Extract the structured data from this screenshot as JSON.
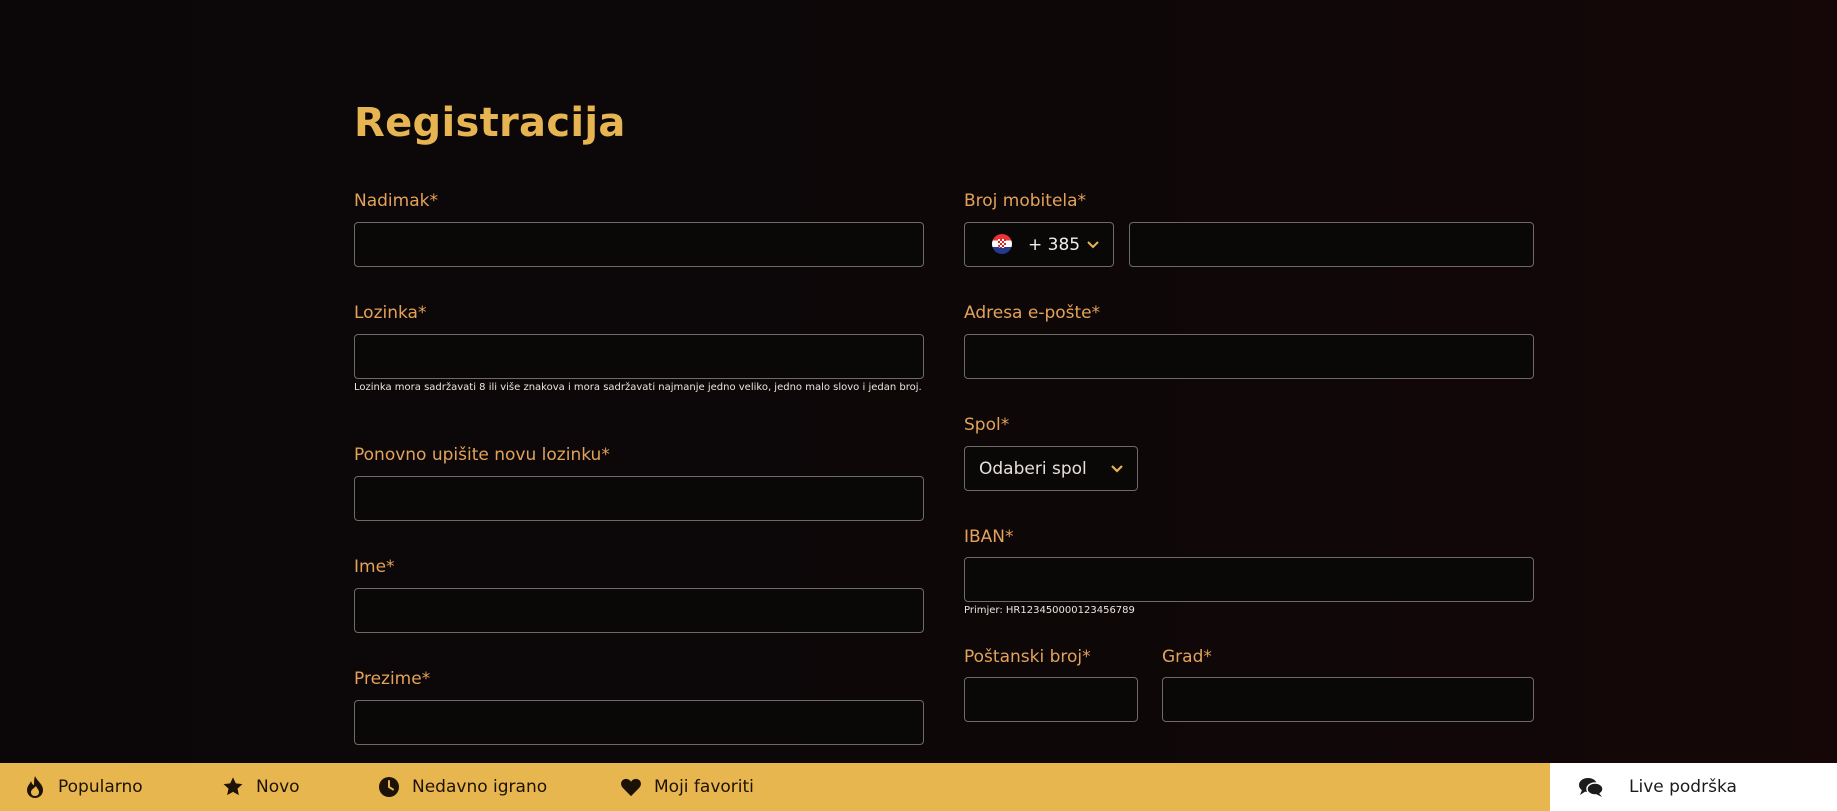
{
  "page": {
    "title": "Registracija"
  },
  "form": {
    "nickname": {
      "label": "Nadimak*",
      "value": ""
    },
    "password": {
      "label": "Lozinka*",
      "value": "",
      "hint": "Lozinka mora sadržavati 8 ili više znakova i mora sadržavati najmanje jedno veliko, jedno malo slovo i jedan broj."
    },
    "password_repeat": {
      "label": "Ponovno upišite novu lozinku*",
      "value": ""
    },
    "first_name": {
      "label": "Ime*",
      "value": ""
    },
    "last_name": {
      "label": "Prezime*",
      "value": ""
    },
    "phone": {
      "label": "Broj mobitela*",
      "country_code": "+ 385",
      "flag_icon": "croatia-flag-icon",
      "value": ""
    },
    "email": {
      "label": "Adresa e-pošte*",
      "value": ""
    },
    "gender": {
      "label": "Spol*",
      "selected": "Odaberi spol"
    },
    "iban": {
      "label": "IBAN*",
      "value": "",
      "hint": "Primjer: HR1234500001234567​89"
    },
    "postal_code": {
      "label": "Poštanski broj*",
      "value": ""
    },
    "city": {
      "label": "Grad*",
      "value": ""
    }
  },
  "bottom_nav": {
    "items": [
      {
        "label": "Popularno",
        "icon": "fire-icon"
      },
      {
        "label": "Novo",
        "icon": "star-icon"
      },
      {
        "label": "Nedavno igrano",
        "icon": "clock-icon"
      },
      {
        "label": "Moji favoriti",
        "icon": "heart-icon"
      }
    ],
    "support": {
      "label": "Live podrška",
      "icon": "chat-icon"
    }
  },
  "colors": {
    "accent": "#e6b552",
    "label": "#e3a25a",
    "background": "#0b0708",
    "bottom_bar": "#e8b64e"
  }
}
